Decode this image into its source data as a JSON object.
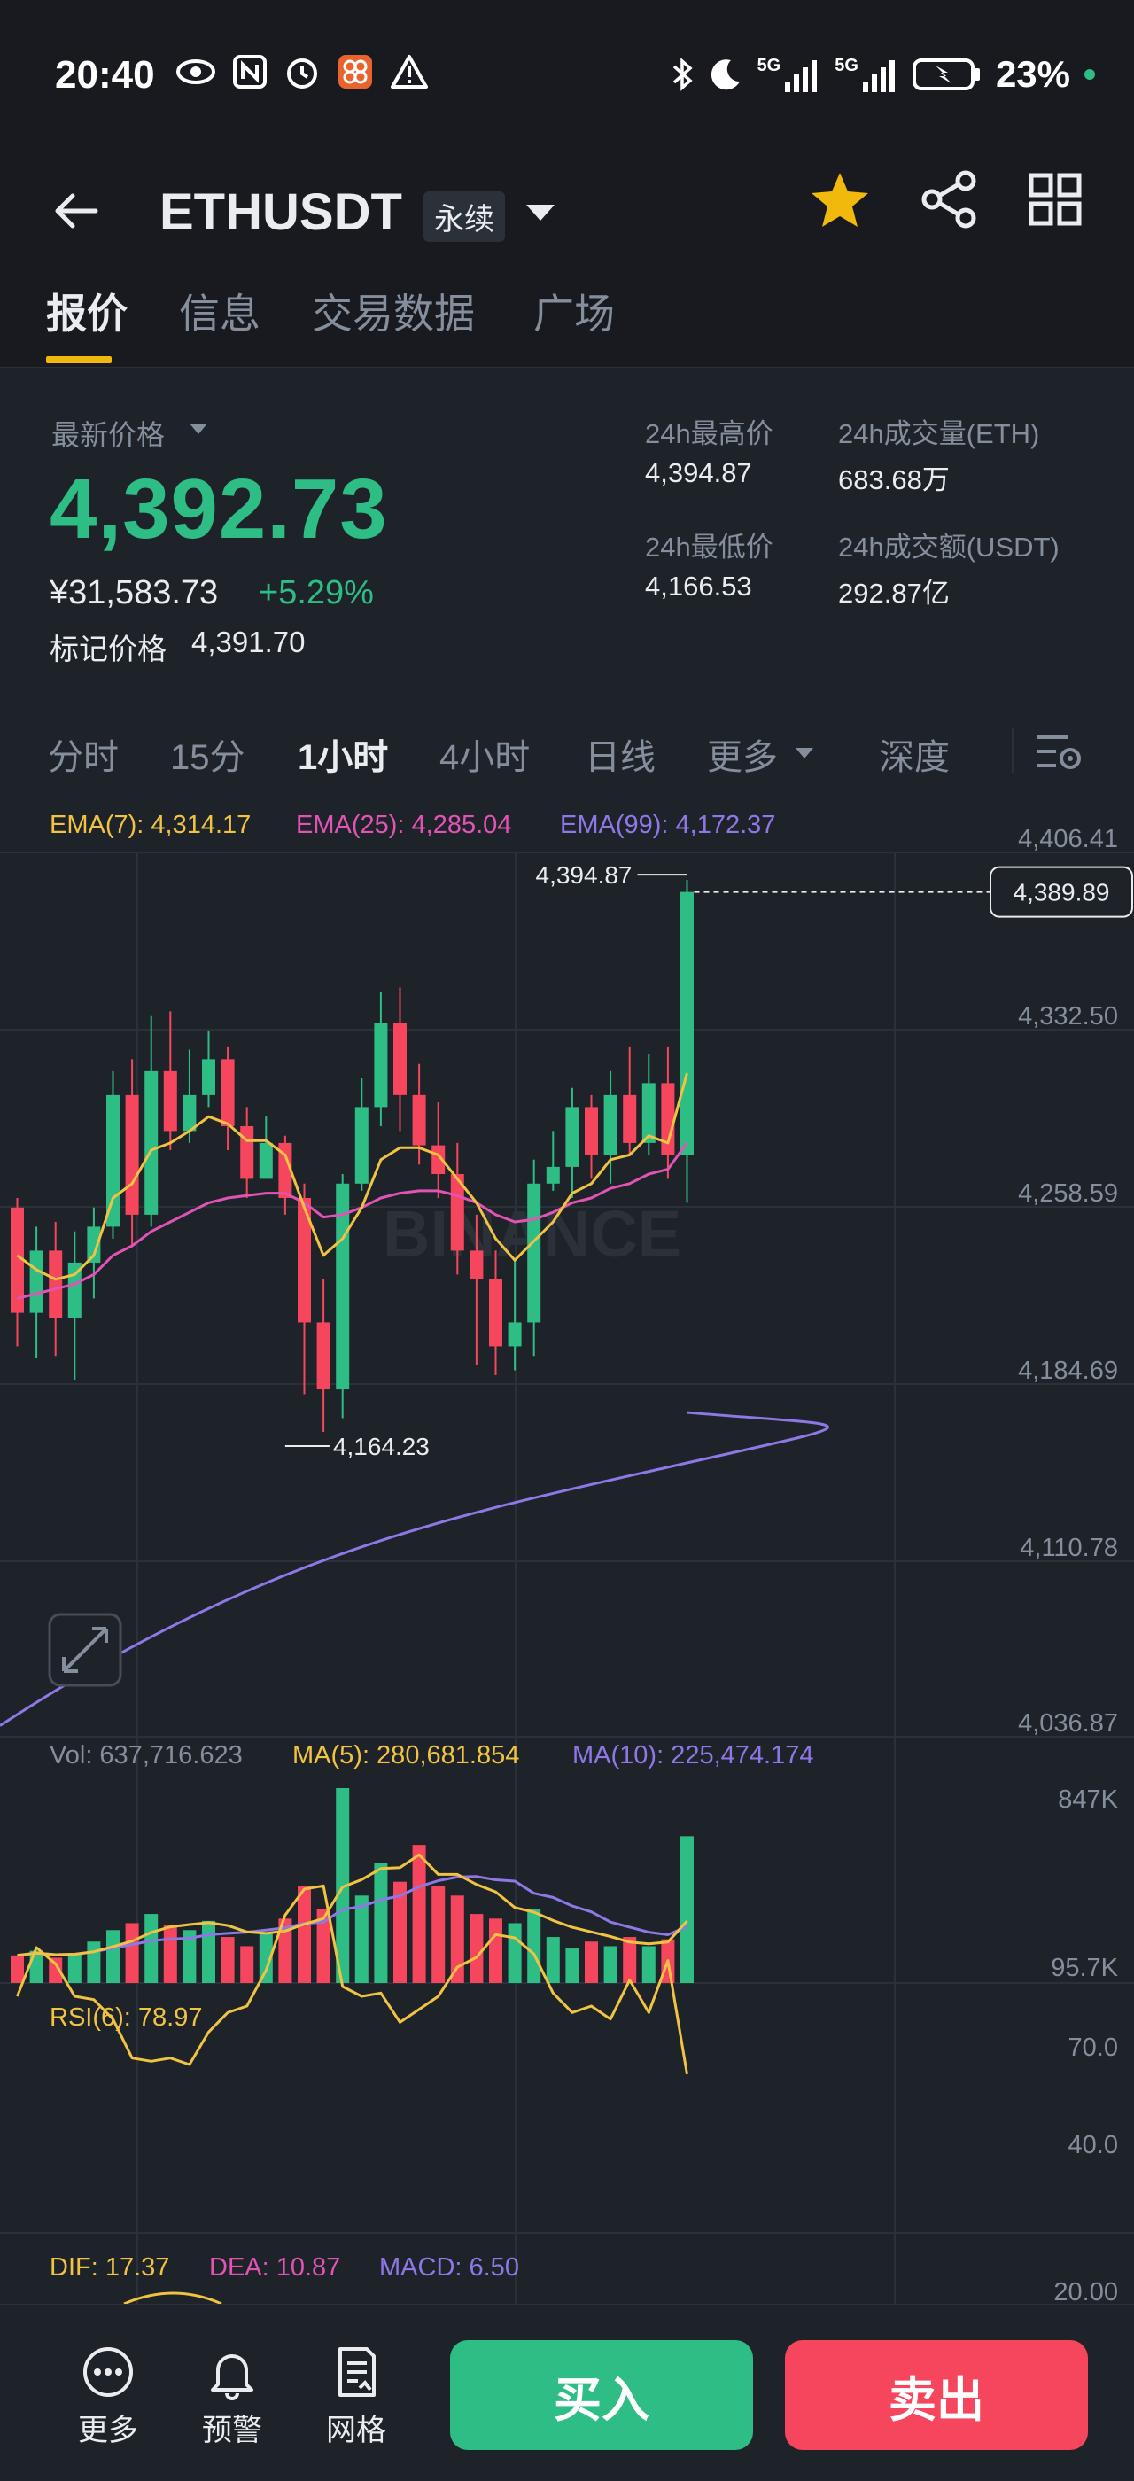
{
  "status_bar": {
    "time": "20:40",
    "battery": "23%",
    "network_1": "5G",
    "network_2": "5G"
  },
  "header": {
    "title": "ETHUSDT",
    "badge": "永续"
  },
  "tabs": [
    {
      "label": "报价",
      "active": true
    },
    {
      "label": "信息",
      "active": false
    },
    {
      "label": "交易数据",
      "active": false
    },
    {
      "label": "广场",
      "active": false
    }
  ],
  "price": {
    "latest_label": "最新价格",
    "last": "4,392.73",
    "cny": "¥31,583.73",
    "change": "+5.29%",
    "mark_label": "标记价格",
    "mark_value": "4,391.70"
  },
  "stats": {
    "high_label": "24h最高价",
    "high_value": "4,394.87",
    "low_label": "24h最低价",
    "low_value": "4,166.53",
    "vol_eth_label": "24h成交量(ETH)",
    "vol_eth_value": "683.68万",
    "vol_usdt_label": "24h成交额(USDT)",
    "vol_usdt_value": "292.87亿"
  },
  "intervals": [
    {
      "label": "分时",
      "active": false
    },
    {
      "label": "15分",
      "active": false
    },
    {
      "label": "1小时",
      "active": true
    },
    {
      "label": "4小时",
      "active": false
    },
    {
      "label": "日线",
      "active": false
    },
    {
      "label": "更多",
      "active": false
    },
    {
      "label": "深度",
      "active": false
    }
  ],
  "indicators": {
    "ema7": "EMA(7): 4,314.17",
    "ema25": "EMA(25): 4,285.04",
    "ema99": "EMA(99): 4,172.37",
    "vol": "Vol: 637,716.623",
    "ma5": "MA(5): 280,681.854",
    "ma10": "MA(10): 225,474.174",
    "rsi": "RSI(6): 78.97",
    "dif": "DIF: 17.37",
    "dea": "DEA: 10.87",
    "macd": "MACD: 6.50"
  },
  "chart_data": {
    "type": "candlestick",
    "watermark": "BINANCE",
    "price_axis": [
      "4,406.41",
      "4,332.50",
      "4,258.59",
      "4,184.69",
      "4,110.78",
      "4,036.87"
    ],
    "ylim": [
      4036.87,
      4406.41
    ],
    "current_price_tag": "4,389.89",
    "current_price": 4389.89,
    "high_marker": {
      "label": "4,394.87",
      "value": 4394.87,
      "index": 35
    },
    "low_marker": {
      "label": "4,164.23",
      "value": 4164.23,
      "index": 14
    },
    "candles": [
      [
        4258,
        4214,
        4262,
        4200
      ],
      [
        4214,
        4240,
        4250,
        4195
      ],
      [
        4240,
        4212,
        4252,
        4196
      ],
      [
        4212,
        4235,
        4248,
        4186
      ],
      [
        4235,
        4250,
        4258,
        4220
      ],
      [
        4250,
        4305,
        4315,
        4245
      ],
      [
        4305,
        4255,
        4320,
        4242
      ],
      [
        4255,
        4315,
        4338,
        4250
      ],
      [
        4315,
        4290,
        4340,
        4282
      ],
      [
        4290,
        4305,
        4324,
        4285
      ],
      [
        4305,
        4320,
        4332,
        4300
      ],
      [
        4320,
        4292,
        4325,
        4282
      ],
      [
        4292,
        4270,
        4300,
        4262
      ],
      [
        4270,
        4285,
        4296,
        4270
      ],
      [
        4285,
        4262,
        4288,
        4255
      ],
      [
        4262,
        4210,
        4268,
        4180
      ],
      [
        4210,
        4182,
        4228,
        4164.23
      ],
      [
        4182,
        4268,
        4272,
        4170
      ],
      [
        4268,
        4300,
        4312,
        4265
      ],
      [
        4300,
        4335,
        4348,
        4292
      ],
      [
        4335,
        4305,
        4350,
        4290
      ],
      [
        4305,
        4284,
        4318,
        4276
      ],
      [
        4284,
        4272,
        4302,
        4262
      ],
      [
        4272,
        4240,
        4285,
        4230
      ],
      [
        4240,
        4228,
        4255,
        4192
      ],
      [
        4228,
        4200,
        4240,
        4188
      ],
      [
        4200,
        4210,
        4236,
        4190
      ],
      [
        4210,
        4268,
        4278,
        4196
      ],
      [
        4268,
        4275,
        4290,
        4265
      ],
      [
        4275,
        4300,
        4308,
        4262
      ],
      [
        4300,
        4280,
        4305,
        4270
      ],
      [
        4280,
        4305,
        4315,
        4268
      ],
      [
        4305,
        4285,
        4325,
        4280
      ],
      [
        4285,
        4310,
        4322,
        4280
      ],
      [
        4310,
        4280,
        4325,
        4270
      ],
      [
        4280,
        4389.89,
        4394.87,
        4260
      ]
    ],
    "ema7": [
      4238,
      4232,
      4228,
      4230,
      4238,
      4262,
      4268,
      4282,
      4285,
      4290,
      4296,
      4293,
      4286,
      4286,
      4280,
      4258,
      4238,
      4245,
      4258,
      4278,
      4283,
      4283,
      4280,
      4270,
      4260,
      4245,
      4236,
      4244,
      4252,
      4264,
      4268,
      4278,
      4280,
      4288,
      4285,
      4314.17
    ],
    "ema25": [
      4220,
      4222,
      4224,
      4226,
      4230,
      4238,
      4242,
      4248,
      4252,
      4256,
      4260,
      4262,
      4263,
      4264,
      4264,
      4260,
      4254,
      4255,
      4258,
      4262,
      4264,
      4265,
      4265,
      4263,
      4260,
      4255,
      4252,
      4253,
      4256,
      4260,
      4262,
      4266,
      4268,
      4272,
      4274,
      4285.04
    ],
    "ema99_start": [
      4040,
      4172.37
    ],
    "volume_axis": [
      "847K",
      "95.7K"
    ],
    "volumes": [
      120,
      140,
      110,
      130,
      180,
      230,
      260,
      300,
      250,
      230,
      270,
      200,
      160,
      220,
      280,
      420,
      320,
      847,
      380,
      520,
      440,
      600,
      420,
      380,
      300,
      280,
      260,
      320,
      200,
      150,
      180,
      160,
      200,
      160,
      190,
      637.7
    ],
    "rsi_axis": [
      "70.0",
      "40.0"
    ],
    "rsi": [
      55,
      40,
      45,
      55,
      56,
      62,
      74,
      75,
      74,
      76,
      66,
      60,
      58,
      47,
      30,
      22,
      21,
      52,
      55,
      54,
      63,
      59,
      55,
      46,
      43,
      36,
      37,
      42,
      54,
      60,
      58,
      62,
      50,
      60,
      44,
      78.97
    ],
    "macd_axis": [
      "20.00"
    ]
  },
  "bottom_bar": {
    "more_label": "更多",
    "alert_label": "预警",
    "grid_label": "网格",
    "buy_label": "买入",
    "sell_label": "卖出"
  },
  "colors": {
    "up": "#2ebd85",
    "down": "#f6465d",
    "accent": "#f0b90b",
    "ema7": "#f0c343",
    "ema25": "#e153b4",
    "ema99": "#8e78e8"
  }
}
